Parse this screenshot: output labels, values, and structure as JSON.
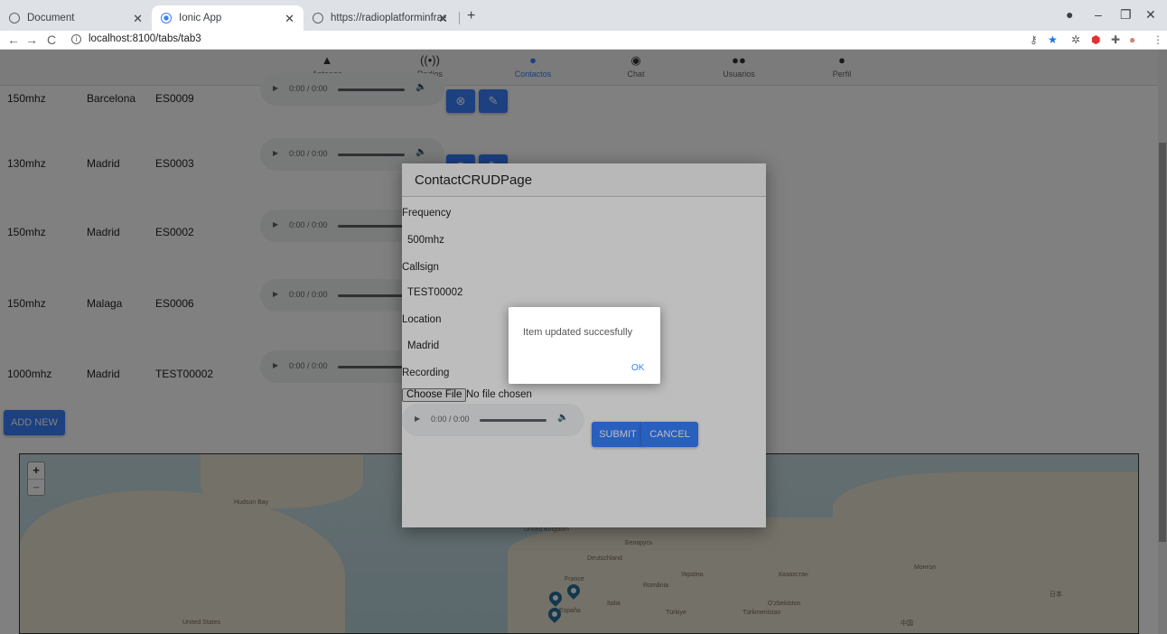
{
  "browser": {
    "tabs": [
      {
        "title": "Document"
      },
      {
        "title": "Ionic App"
      },
      {
        "title": "https://radioplatforminfrastructu"
      }
    ],
    "url": "localhost:8100/tabs/tab3"
  },
  "nav": {
    "tabs": [
      {
        "label": "Antenas",
        "icon": "triangle-icon"
      },
      {
        "label": "Radios",
        "icon": "radio-icon"
      },
      {
        "label": "Contactos",
        "icon": "person-icon"
      },
      {
        "label": "Chat",
        "icon": "chat-icon"
      },
      {
        "label": "Usuarios",
        "icon": "people-icon"
      },
      {
        "label": "Perfil",
        "icon": "person-icon"
      }
    ],
    "active": "Contactos"
  },
  "contacts": [
    {
      "frequency": "150mhz",
      "location": "Barcelona",
      "callsign": "ES0009"
    },
    {
      "frequency": "130mhz",
      "location": "Madrid",
      "callsign": "ES0003"
    },
    {
      "frequency": "150mhz",
      "location": "Madrid",
      "callsign": "ES0002"
    },
    {
      "frequency": "150mhz",
      "location": "Malaga",
      "callsign": "ES0006"
    },
    {
      "frequency": "1000mhz",
      "location": "Madrid",
      "callsign": "TEST00002"
    }
  ],
  "audio_time": "0:00 / 0:00",
  "add_new_label": "ADD NEW",
  "map": {
    "labels": {
      "united_states": "United States",
      "hudson_bay": "Hudson Bay",
      "united_kingdom": "United Kingdom",
      "belarus": "Беларусь",
      "deutschland": "Deutschland",
      "ukraina": "Україна",
      "kazakhstan": "Казахстан",
      "mongolia": "Монгол",
      "france": "France",
      "romania": "România",
      "italia": "Italia",
      "turkiye": "Türkiye",
      "uzbekistan": "O'zbekiston",
      "turkmenistan": "Türkmenistan",
      "japan": "日本",
      "china": "中国",
      "espana": "España"
    }
  },
  "modal": {
    "title": "ContactCRUDPage",
    "frequency_label": "Frequency",
    "frequency_value": "500mhz",
    "callsign_label": "Callsign",
    "callsign_value": "TEST00002",
    "location_label": "Location",
    "location_value": "Madrid",
    "recording_label": "Recording",
    "choose_file": "Choose File",
    "no_file": "No file chosen",
    "submit": "SUBMIT",
    "cancel": "CANCEL"
  },
  "alert": {
    "message": "Item updated succesfully",
    "ok": "OK"
  }
}
